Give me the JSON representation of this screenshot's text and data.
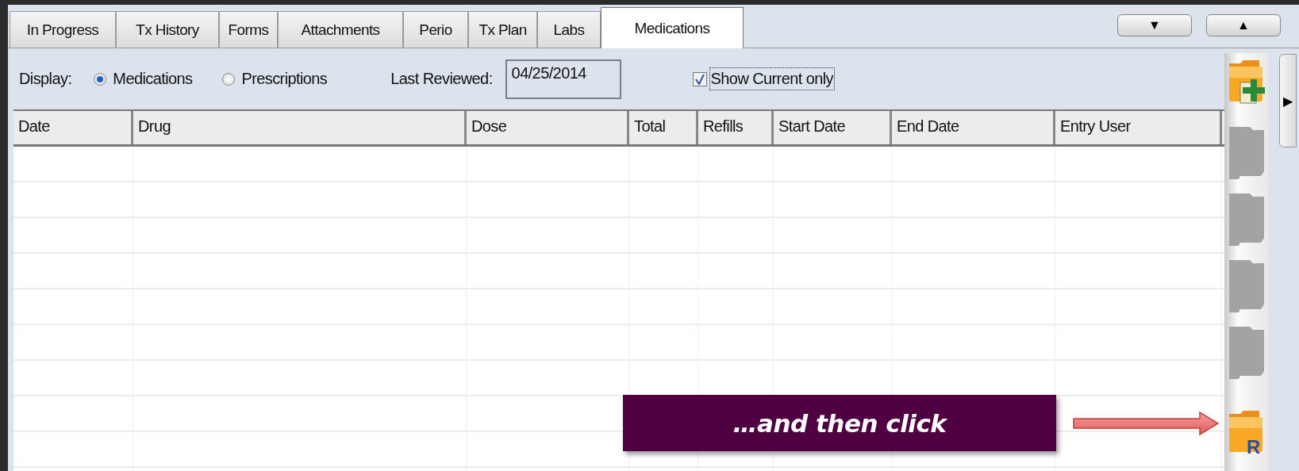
{
  "tabs": [
    {
      "label": "In Progress",
      "selected": false
    },
    {
      "label": "Tx History",
      "selected": false
    },
    {
      "label": "Forms",
      "selected": false
    },
    {
      "label": "Attachments",
      "selected": false
    },
    {
      "label": "Perio",
      "selected": false
    },
    {
      "label": "Tx Plan",
      "selected": false
    },
    {
      "label": "Labs",
      "selected": false
    },
    {
      "label": "Medications",
      "selected": true
    }
  ],
  "scroll_buttons": [
    {
      "label": "▼"
    },
    {
      "label": "▲"
    }
  ],
  "filter": {
    "display_label": "Display:",
    "options": [
      {
        "label": "Medications",
        "selected": true
      },
      {
        "label": "Prescriptions",
        "selected": false
      }
    ],
    "last_reviewed_label": "Last Reviewed:",
    "last_reviewed": "04/25/2014",
    "show_current": {
      "label": "Show Current only",
      "checked": true
    }
  },
  "table": {
    "columns": [
      "Date",
      "Drug",
      "Dose",
      "Total",
      "Refills",
      "Start Date",
      "End Date",
      "Entry User"
    ]
  },
  "toolbar": [
    {
      "kind": "add",
      "disabled": false
    },
    {
      "kind": "plain",
      "disabled": true
    },
    {
      "kind": "plain",
      "disabled": true
    },
    {
      "kind": "plain",
      "disabled": true
    },
    {
      "kind": "plain",
      "disabled": true
    },
    {
      "kind": "letter",
      "badge": "R",
      "disabled": false
    }
  ],
  "side_button": {
    "label": "▶"
  },
  "callout": {
    "text": "…and then click"
  }
}
